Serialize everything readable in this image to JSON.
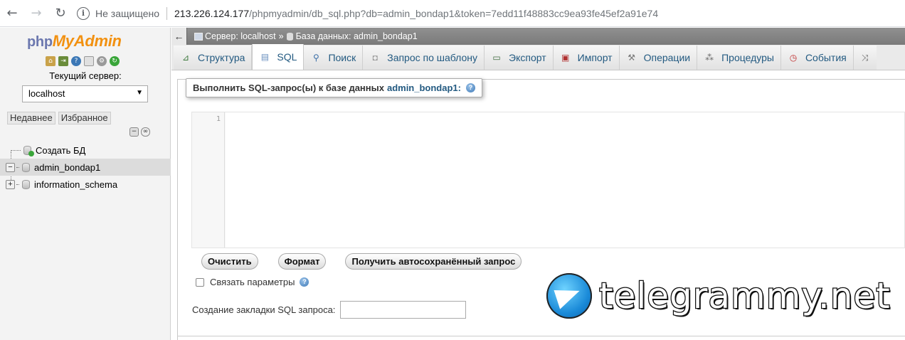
{
  "browser": {
    "security_label": "Не защищено",
    "url_host": "213.226.124.177",
    "url_path": "/phpmyadmin/db_sql.php?db=admin_bondap1&token=7edd11f48883cc9ea93fe45ef2a91e74"
  },
  "sidebar": {
    "logo_php": "php",
    "logo_myadmin": "MyAdmin",
    "current_server_label": "Текущий сервер:",
    "server_value": "localhost",
    "recent_tab": "Недавнее",
    "favorites_tab": "Избранное",
    "tree": {
      "create_db": "Создать БД",
      "db1": "admin_bondap1",
      "db2": "information_schema"
    }
  },
  "breadcrumb": {
    "server": "Сервер: localhost",
    "separator": "»",
    "database": "База данных: admin_bondap1"
  },
  "tabs": [
    {
      "label": "Структура",
      "icon": "structure-icon"
    },
    {
      "label": "SQL",
      "icon": "sql-icon"
    },
    {
      "label": "Поиск",
      "icon": "search-icon"
    },
    {
      "label": "Запрос по шаблону",
      "icon": "query-icon"
    },
    {
      "label": "Экспорт",
      "icon": "export-icon"
    },
    {
      "label": "Импорт",
      "icon": "import-icon"
    },
    {
      "label": "Операции",
      "icon": "wrench-icon"
    },
    {
      "label": "Процедуры",
      "icon": "routines-icon"
    },
    {
      "label": "События",
      "icon": "clock-icon"
    }
  ],
  "sql_panel": {
    "legend_text": "Выполнить SQL-запрос(ы) к базе данных",
    "legend_db": "admin_bondap1:",
    "line_number": "1",
    "clear_button": "Очистить",
    "format_button": "Формат",
    "autosave_button": "Получить автосохранённый запрос",
    "bind_params_label": "Связать параметры",
    "bookmark_label": "Создание закладки SQL запроса:"
  },
  "watermark": {
    "text": "telegrammy.net"
  }
}
